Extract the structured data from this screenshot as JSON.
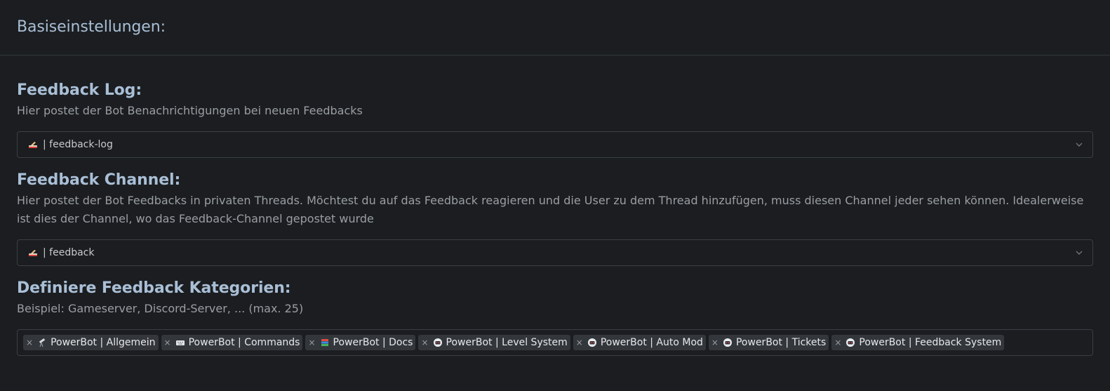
{
  "header": {
    "title": "Basiseinstellungen:"
  },
  "feedback_log": {
    "title": "Feedback Log:",
    "description": "Hier postet der Bot Benachrichtigungen bei neuen Feedbacks",
    "selected_value": "| feedback-log",
    "icon": "writing-hand-icon"
  },
  "feedback_channel": {
    "title": "Feedback Channel:",
    "description": "Hier postet der Bot Feedbacks in privaten Threads. Möchtest du auf das Feedback reagieren und die User zu dem Thread hinzufügen, muss diesen Channel jeder sehen können. Idealerweise ist dies der Channel, wo das Feedback-Channel gepostet wurde",
    "selected_value": "| feedback",
    "icon": "writing-hand-icon"
  },
  "categories": {
    "title": "Definiere Feedback Kategorien:",
    "description": "Beispiel: Gameserver, Discord-Server, ... (max. 25)",
    "remove_symbol": "×",
    "tags": [
      {
        "label": "PowerBot | Allgemein",
        "icon": "telescope-icon"
      },
      {
        "label": "PowerBot | Commands",
        "icon": "keyboard-icon"
      },
      {
        "label": "PowerBot | Docs",
        "icon": "books-icon"
      },
      {
        "label": "PowerBot | Level System",
        "icon": "robot-icon"
      },
      {
        "label": "PowerBot | Auto Mod",
        "icon": "robot-icon"
      },
      {
        "label": "PowerBot | Tickets",
        "icon": "robot-icon"
      },
      {
        "label": "PowerBot | Feedback System",
        "icon": "robot-icon"
      }
    ]
  },
  "colors": {
    "background": "#1b1d20",
    "heading": "#a9bfd6",
    "muted_text": "#9a9ea3",
    "border": "#3b3f45",
    "tag_bg": "#33373c"
  }
}
